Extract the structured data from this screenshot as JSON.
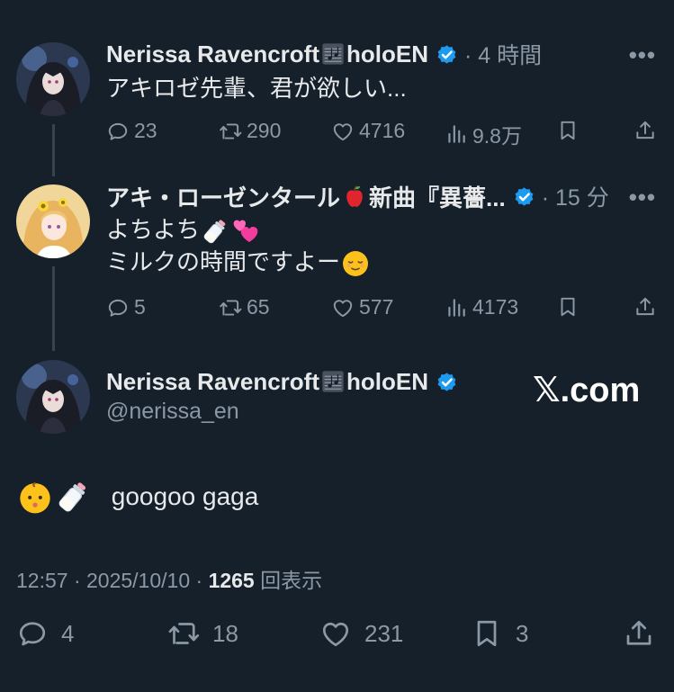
{
  "tweets": [
    {
      "name": "Nerissa Ravencroft",
      "name_suffix": "holoEN",
      "time": "· 4 時間",
      "text_lines": [
        "アキロゼ先輩、君が欲しい..."
      ],
      "replies": "23",
      "retweets": "290",
      "likes": "4716",
      "views": "9.8万"
    },
    {
      "name": "アキ・ローゼンタール",
      "name_suffix": "新曲『異薔...",
      "time": "· 15 分",
      "text_lines": [
        "よちよち",
        "ミルクの時間ですよー"
      ],
      "replies": "5",
      "retweets": "65",
      "likes": "577",
      "views": "4173"
    }
  ],
  "main": {
    "name": "Nerissa Ravencroft",
    "name_suffix": "holoEN",
    "handle": "@nerissa_en",
    "watermark": "𝕏.com",
    "text": "googoo gaga",
    "time": "12:57 · 2025/10/10 · ",
    "view_count": "1265",
    "view_label": " 回表示",
    "replies": "4",
    "retweets": "18",
    "likes": "231",
    "bookmarks": "3"
  },
  "more_label": "•••",
  "colors": {
    "background": "#15202b",
    "verified": "#1d9bf0",
    "muted": "#8b98a5",
    "text": "#e7e9ea",
    "thread_line": "#38444d"
  },
  "icons": [
    "reply-icon",
    "retweet-icon",
    "like-icon",
    "views-icon",
    "bookmark-icon",
    "share-icon",
    "verified-icon",
    "music-score-icon",
    "apple-icon",
    "baby-bottle-icon",
    "two-hearts-icon",
    "relieved-face-icon",
    "baby-face-icon"
  ]
}
